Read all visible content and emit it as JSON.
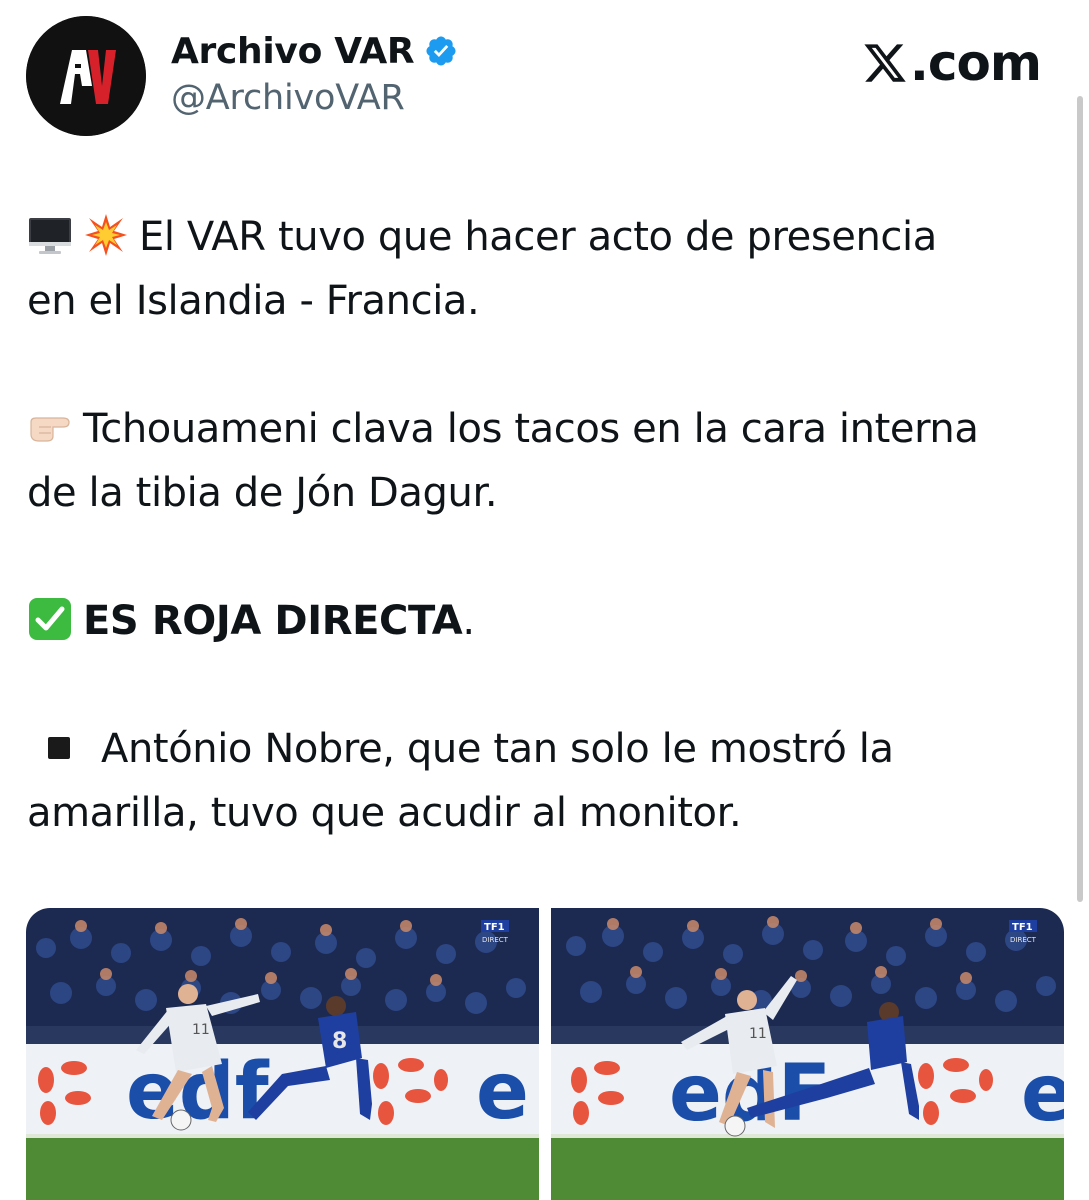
{
  "account": {
    "display_name": "Archivo VAR",
    "handle": "@ArchivoVAR",
    "avatar_letters": "AV",
    "verified": true
  },
  "brand": {
    "site": ".com",
    "logo_icon": "x-logo-icon"
  },
  "tweet": {
    "line1": "El VAR tuvo que hacer acto de presencia",
    "line1_cont": "en el Islandia - Francia.",
    "line2": "Tchouameni clava los tacos en la cara interna",
    "line2_cont": "de la tibia de Jón Dagur.",
    "line3_bold": "ES ROJA DIRECTA",
    "line3_end": ".",
    "line4": "António Nobre, que tan solo le mostró la",
    "line4_cont": "amarilla, tuvo que acudir al monitor.",
    "emojis": [
      "desktop-computer-icon",
      "collision-icon",
      "pointing-right-icon",
      "check-mark-button-icon",
      "black-square-icon"
    ]
  },
  "media": {
    "items": [
      {
        "broadcaster": "TF1",
        "broadcaster_sub": "DIRECT",
        "ad_text": "edf",
        "jersey_white": "11",
        "jersey_blue": "8"
      },
      {
        "broadcaster": "TF1",
        "broadcaster_sub": "DIRECT",
        "ad_text": "edf",
        "jersey_white": "11"
      }
    ]
  },
  "colors": {
    "verified_blue": "#1d9bf0",
    "text": "#0f1419",
    "secondary_text": "#536471",
    "avatar_red": "#d6212b"
  }
}
